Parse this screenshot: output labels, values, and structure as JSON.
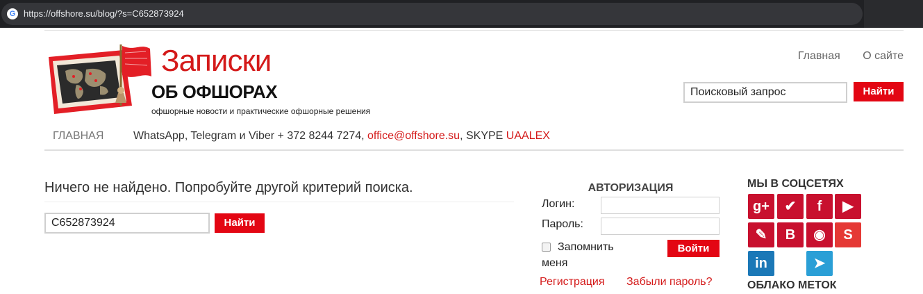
{
  "browser": {
    "url": "https://offshore.su/blog/?s=C652873924",
    "favicon": "G"
  },
  "logo": {
    "title": "Записки",
    "subtitle": "ОБ ОФШОРАХ",
    "tagline": "офшорные новости и практические офшорные решения"
  },
  "top_nav": {
    "home": "Главная",
    "about": "О сайте"
  },
  "header_search": {
    "placeholder": "Поисковый запрос",
    "button": "Найти"
  },
  "menu": {
    "home": "ГЛАВНАЯ",
    "contact_prefix": "WhatsApp, Telegram и Viber + 372 8244 7274,",
    "email": "office@offshore.su",
    "skype_prefix": ", SKYPE",
    "skype": "UAALEX"
  },
  "main": {
    "message": "Ничего не найдено. Попробуйте другой критерий поиска.",
    "search_value": "C652873924",
    "search_button": "Найти"
  },
  "auth": {
    "title": "АВТОРИЗАЦИЯ",
    "login_label": "Логин:",
    "password_label": "Пароль:",
    "remember_line1": "Запомнить",
    "remember_line2": "меня",
    "login_button": "Войти",
    "register": "Регистрация",
    "forgot": "Забыли пароль?"
  },
  "socials": {
    "title": "МЫ В СОЦСЕТЯХ",
    "items": [
      {
        "icon": "google-plus-icon",
        "glyph": "g+",
        "color": "#c8102e"
      },
      {
        "icon": "twitter-icon",
        "glyph": "✔",
        "color": "#c8102e"
      },
      {
        "icon": "facebook-icon",
        "glyph": "f",
        "color": "#c8102e"
      },
      {
        "icon": "youtube-icon",
        "glyph": "▶",
        "color": "#c8102e"
      },
      {
        "icon": "livejournal-icon",
        "glyph": "✎",
        "color": "#c8102e"
      },
      {
        "icon": "vkontakte-icon",
        "glyph": "B",
        "color": "#c8102e"
      },
      {
        "icon": "rss-icon",
        "glyph": "◉",
        "color": "#c8102e"
      },
      {
        "icon": "sina-weibo-icon",
        "glyph": "S",
        "color": "#e53935"
      },
      {
        "icon": "linkedin-icon",
        "glyph": "in",
        "color": "#1b78b7"
      },
      {
        "icon": "telegram-icon",
        "glyph": "➤",
        "color": "#2a9fd6"
      }
    ]
  },
  "tags": {
    "title": "ОБЛАКО МЕТОК"
  }
}
